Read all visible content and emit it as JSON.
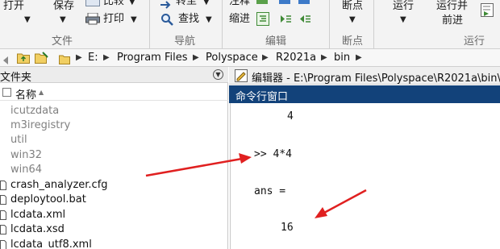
{
  "ribbon": {
    "open_label": "打开",
    "save_label": "保存",
    "compare_label": "比较",
    "print_label": "打印",
    "goto_label": "转至",
    "find_label": "查找",
    "comment_label": "注释",
    "indent_label": "缩进",
    "breakpoints_label": "断点",
    "run_label": "运行",
    "run_advance_label": "运行并",
    "run_advance_label_2": "前进",
    "groups": {
      "file": "文件",
      "navigate": "导航",
      "edit": "编辑",
      "breakpoints": "断点",
      "run": "运行"
    }
  },
  "address": {
    "segments": [
      "E:",
      "Program Files",
      "Polyspace",
      "R2021a",
      "bin"
    ]
  },
  "file_panel": {
    "title": "文件夹",
    "column_name": "名称",
    "sort_glyph": "▲",
    "collapse_glyph": "▼",
    "files": [
      {
        "name": "icutzdata",
        "type": "folder"
      },
      {
        "name": "m3iregistry",
        "type": "folder"
      },
      {
        "name": "util",
        "type": "folder"
      },
      {
        "name": "win32",
        "type": "folder"
      },
      {
        "name": "win64",
        "type": "folder"
      },
      {
        "name": "crash_analyzer.cfg",
        "type": "file"
      },
      {
        "name": "deploytool.bat",
        "type": "file"
      },
      {
        "name": "lcdata.xml",
        "type": "file"
      },
      {
        "name": "lcdata.xsd",
        "type": "file"
      },
      {
        "name": "lcdata_utf8.xml",
        "type": "file"
      }
    ]
  },
  "editor": {
    "title": "编辑器 - E:\\Program Files\\Polyspace\\R2021a\\bin\\"
  },
  "command_window": {
    "title": "命令行窗口",
    "lines": [
      "4",
      ">> 4*4",
      "ans =",
      "16"
    ]
  },
  "colors": {
    "command_header": "#12427a",
    "annotation_arrow": "#e02020",
    "folder_text": "#808080"
  }
}
